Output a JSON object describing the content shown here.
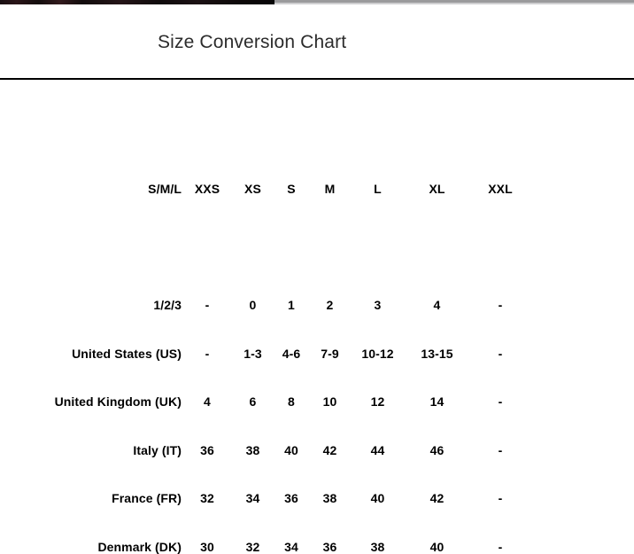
{
  "page": {
    "title": "Size Conversion Chart",
    "background_color": "#ffffff",
    "text_color": "#000000",
    "title_color": "#2c2c2c",
    "divider_color": "#000000"
  },
  "table": {
    "columns": [
      "S/M/L",
      "XXS",
      "XS",
      "S",
      "M",
      "L",
      "XL",
      "XXL"
    ],
    "rows": [
      {
        "label": "1/2/3",
        "values": [
          "-",
          "0",
          "1",
          "2",
          "3",
          "4",
          "-"
        ]
      },
      {
        "label": "United States (US)",
        "values": [
          "-",
          "1-3",
          "4-6",
          "7-9",
          "10-12",
          "13-15",
          "-"
        ]
      },
      {
        "label": "United Kingdom (UK)",
        "values": [
          "4",
          "6",
          "8",
          "10",
          "12",
          "14",
          "-"
        ]
      },
      {
        "label": "Italy (IT)",
        "values": [
          "36",
          "38",
          "40",
          "42",
          "44",
          "46",
          "-"
        ]
      },
      {
        "label": "France (FR)",
        "values": [
          "32",
          "34",
          "36",
          "38",
          "40",
          "42",
          "-"
        ]
      },
      {
        "label": "Denmark (DK)",
        "values": [
          "30",
          "32",
          "34",
          "36",
          "38",
          "40",
          "-"
        ]
      }
    ]
  }
}
